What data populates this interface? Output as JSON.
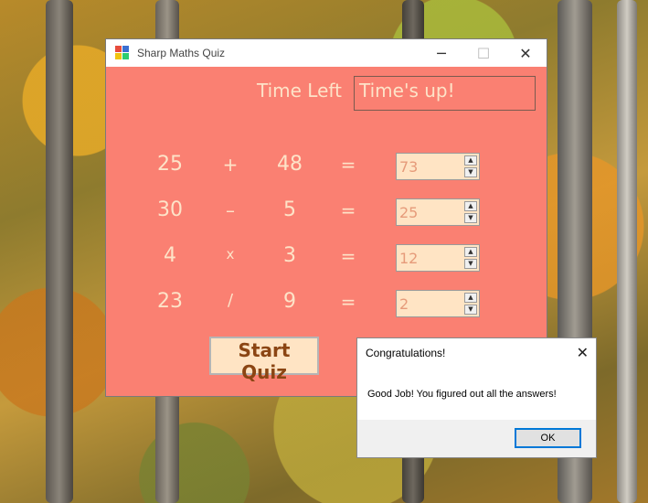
{
  "window": {
    "title": "Sharp Maths Quiz",
    "controls": {
      "minimize": "─",
      "maximize": "☐",
      "close": "✕"
    }
  },
  "timer": {
    "label": "Time Left",
    "value": "Time's up!"
  },
  "problems": [
    {
      "left": "25",
      "op": "+",
      "right": "48",
      "equals": "=",
      "answer": "73"
    },
    {
      "left": "30",
      "op": "–",
      "right": "5",
      "equals": "=",
      "answer": "25"
    },
    {
      "left": "4",
      "op": "x",
      "right": "3",
      "equals": "=",
      "answer": "12"
    },
    {
      "left": "23",
      "op": "/",
      "right": "9",
      "equals": "=",
      "answer": "2"
    }
  ],
  "start_button": {
    "label": "Start Quiz"
  },
  "dialog": {
    "title": "Congratulations!",
    "message": "Good Job! You figured out all the answers!",
    "ok_label": "OK",
    "close": "✕"
  },
  "colors": {
    "form_bg": "#fa8072",
    "text": "#fde3c8",
    "input_bg": "#ffe4c4",
    "button_text": "#8b4513"
  }
}
